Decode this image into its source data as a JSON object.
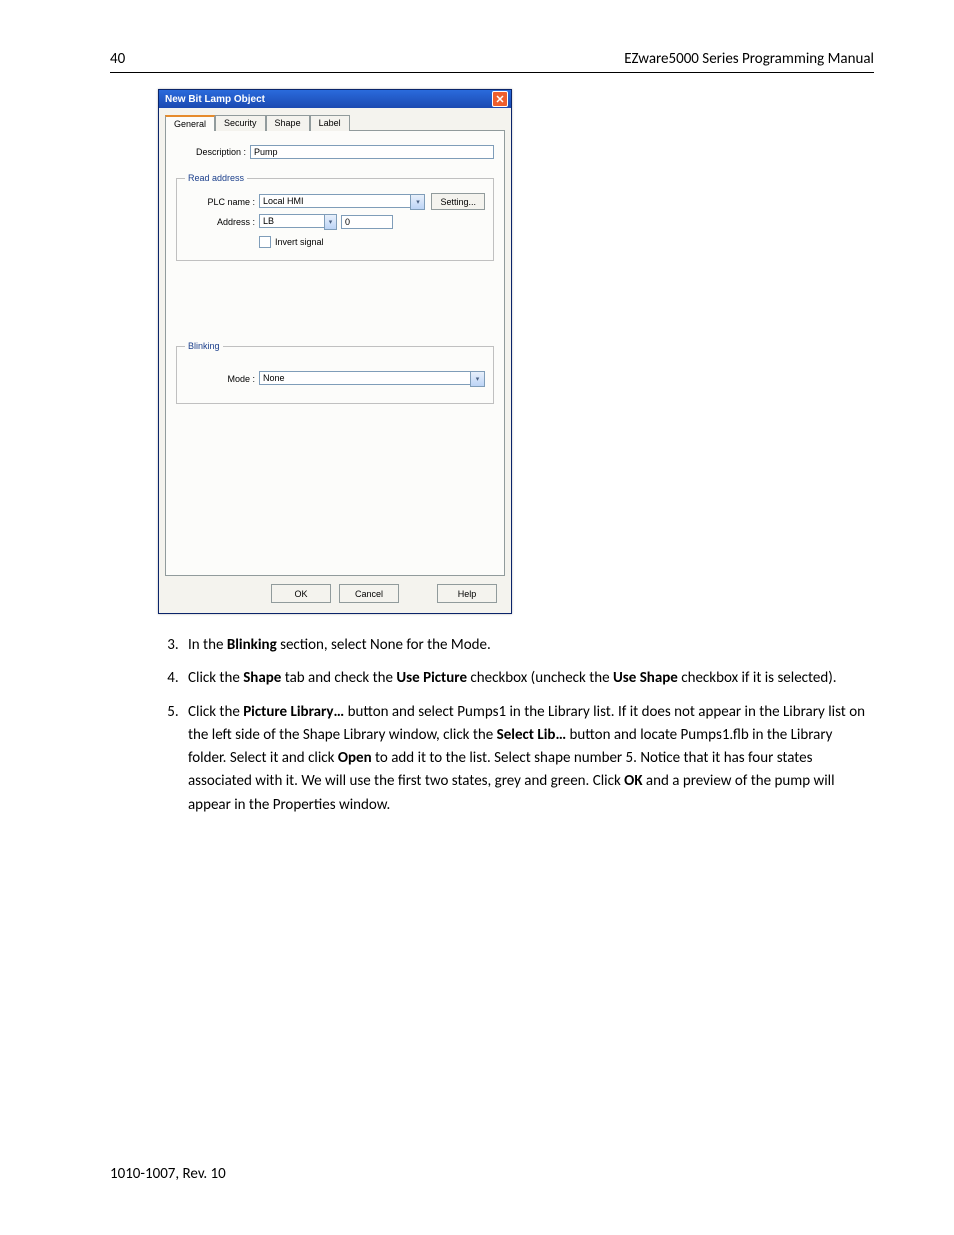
{
  "header": {
    "page_number": "40",
    "manual_title": "EZware5000 Series Programming Manual"
  },
  "dialog": {
    "title": "New  Bit Lamp Object",
    "tabs": [
      "General",
      "Security",
      "Shape",
      "Label"
    ],
    "description_label": "Description :",
    "description_value": "Pump",
    "read_address": {
      "legend": "Read address",
      "plc_name_label": "PLC name :",
      "plc_name_value": "Local HMI",
      "setting_btn": "Setting...",
      "address_label": "Address :",
      "address_type": "LB",
      "address_value": "0",
      "invert_label": "Invert signal"
    },
    "blinking": {
      "legend": "Blinking",
      "mode_label": "Mode :",
      "mode_value": "None"
    },
    "buttons": {
      "ok": "OK",
      "cancel": "Cancel",
      "help": "Help"
    }
  },
  "steps": {
    "s3_a": "In the ",
    "s3_b": "Blinking",
    "s3_c": " section, select None for the Mode.",
    "s4_a": "Click the ",
    "s4_b": "Shape",
    "s4_c": " tab and check the ",
    "s4_d": "Use Picture",
    "s4_e": " checkbox (uncheck the ",
    "s4_f": "Use Shape",
    "s4_g": " checkbox if it is selected).",
    "s5_a": "Click the ",
    "s5_b": "Picture Library…",
    "s5_c": " button and select Pumps1 in the Library list. If it does not appear in the Library list on the left side of the Shape Library window, click the ",
    "s5_d": "Select Lib…",
    "s5_e": " button and locate Pumps1.flb in the Library folder. Select it and click ",
    "s5_f": "Open",
    "s5_g": " to add it to the list. Select shape number 5. Notice that it has four states associated with it. We will use the first two states, grey and green. Click ",
    "s5_h": "OK",
    "s5_i": " and a preview of the pump will appear in the Properties window."
  },
  "footer": "1010-1007, Rev. 10"
}
